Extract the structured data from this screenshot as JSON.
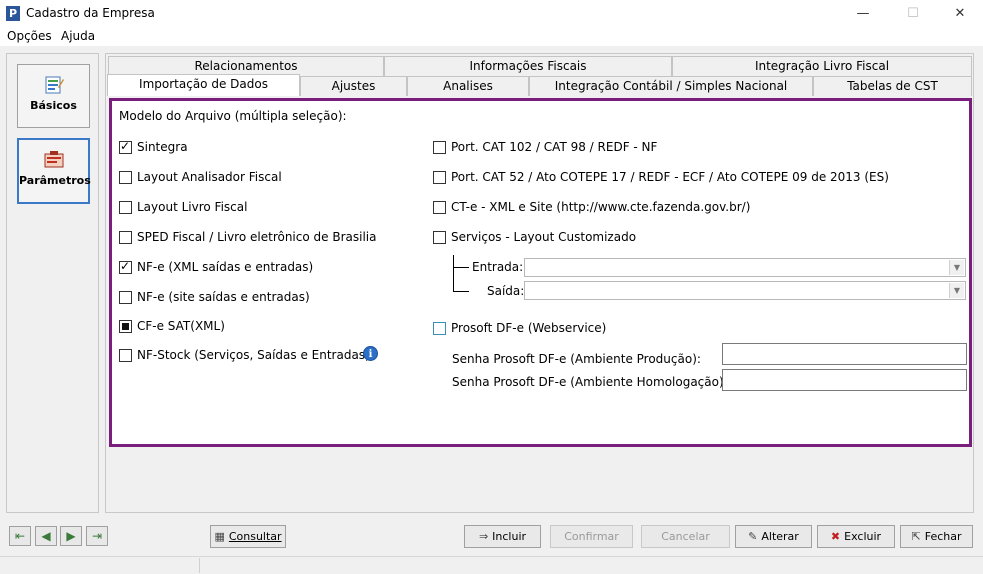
{
  "window": {
    "title": "Cadastro da Empresa",
    "app_icon_letter": "P"
  },
  "menu": {
    "opcoes": "Opções",
    "ajuda": "Ajuda"
  },
  "sidebar": {
    "basicos": "Básicos",
    "parametros": "Parâmetros"
  },
  "tabs": {
    "row1": [
      "Relacionamentos",
      "Informações Fiscais",
      "Integração Livro Fiscal"
    ],
    "row2": [
      "Importação de Dados",
      "Ajustes",
      "Analises",
      "Integração Contábil / Simples Nacional",
      "Tabelas de CST"
    ]
  },
  "content": {
    "model_label": "Modelo do Arquivo (múltipla seleção):",
    "left_options": [
      {
        "label": "Sintegra",
        "state": "checked"
      },
      {
        "label": "Layout Analisador Fiscal",
        "state": "unchecked"
      },
      {
        "label": "Layout Livro Fiscal",
        "state": "unchecked"
      },
      {
        "label": "SPED Fiscal / Livro eletrônico de Brasilia",
        "state": "unchecked"
      },
      {
        "label": "NF-e (XML saídas e entradas)",
        "state": "checked"
      },
      {
        "label": "NF-e (site saídas e entradas)",
        "state": "unchecked"
      },
      {
        "label": "CF-e SAT(XML)",
        "state": "indeterminate"
      },
      {
        "label": "NF-Stock (Serviços, Saídas e Entradas)",
        "state": "unchecked"
      }
    ],
    "right_options": [
      {
        "label": "Port. CAT 102 / CAT 98 / REDF - NF",
        "state": "unchecked"
      },
      {
        "label": "Port. CAT 52 / Ato COTEPE 17 / REDF - ECF / Ato COTEPE 09 de 2013 (ES)",
        "state": "unchecked"
      },
      {
        "label": "CT-e - XML e Site (http://www.cte.fazenda.gov.br/)",
        "state": "unchecked"
      },
      {
        "label": "Serviços - Layout Customizado",
        "state": "unchecked"
      }
    ],
    "entrada_label": "Entrada:",
    "entrada_value": "",
    "saida_label": "Saída:",
    "saida_value": "",
    "prosoft_label": "Prosoft DF-e (Webservice)",
    "senha_producao_label": "Senha Prosoft DF-e (Ambiente Produção):",
    "senha_producao_value": "",
    "senha_homologacao_label": "Senha Prosoft DF-e (Ambiente Homologação):",
    "senha_homologacao_value": "",
    "info_icon": "info-icon"
  },
  "buttons": {
    "consultar": "Consultar",
    "incluir": "Incluir",
    "confirmar": "Confirmar",
    "cancelar": "Cancelar",
    "alterar": "Alterar",
    "excluir": "Excluir",
    "fechar": "Fechar"
  },
  "colors": {
    "frame_accent": "#7a1e7e",
    "active_side_border": "#3a78c8",
    "info_blue": "#2c6fc9"
  }
}
